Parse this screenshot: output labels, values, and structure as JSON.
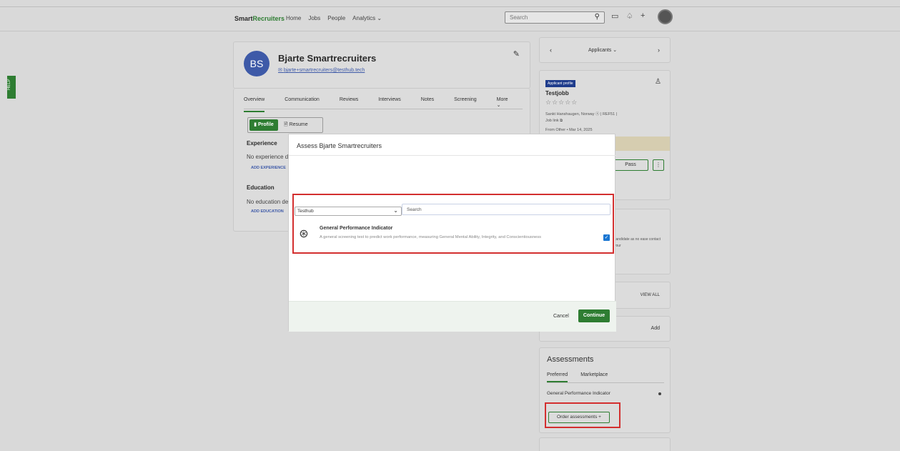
{
  "header": {
    "brand_prefix": "Smart",
    "brand_suffix": "Recruiters",
    "nav": [
      "Home",
      "Jobs",
      "People",
      "Analytics ⌄"
    ],
    "search_placeholder": "Search"
  },
  "help_label": "HELP",
  "candidate": {
    "initials": "BS",
    "name": "Bjarte Smartrecruiters",
    "email": "bjarte+smartrecruiters@testhub.tech"
  },
  "tabs": [
    "Overview",
    "Communication",
    "Reviews",
    "Interviews",
    "Notes",
    "Screening",
    "More ⌄"
  ],
  "profile_toggle": {
    "profile": "Profile",
    "resume": "Resume"
  },
  "sections": {
    "experience_title": "Experience",
    "experience_text": "No experience d",
    "experience_link": "ADD EXPERIENCE",
    "education_title": "Education",
    "education_text": "No education de",
    "education_link": "ADD EDUCATION"
  },
  "right": {
    "nav_label": "Applicants ⌄",
    "badge": "Applicant profile",
    "job": "Testjobb",
    "stars": "☆☆☆☆☆",
    "location": "Sankt Hanshaugen, Norway  ⓢ  |  REF51  |",
    "job_link": "Job link  ⧉",
    "from": "From Other  •  Mar 14, 2025",
    "pass": "Pass",
    "more": "⋮",
    "partial_text": "candidate as no ease contact your",
    "view_all": "VIEW ALL",
    "add": "Add",
    "assessments_title": "Assessments",
    "assessments_tabs": [
      "Preferred",
      "Marketplace"
    ],
    "assessment_item": "General Performance Indicator",
    "order_button": "Order assessments  +"
  },
  "modal": {
    "title": "Assess Bjarte Smartrecruiters",
    "vendor": "Testhub",
    "search_placeholder": "Search",
    "test_name": "General Performance Indicator",
    "test_desc": "A general screening test to predict work performance, measuring General Mental Ability, Integrity, and Conscientiousness",
    "cancel": "Cancel",
    "continue": "Continue"
  }
}
